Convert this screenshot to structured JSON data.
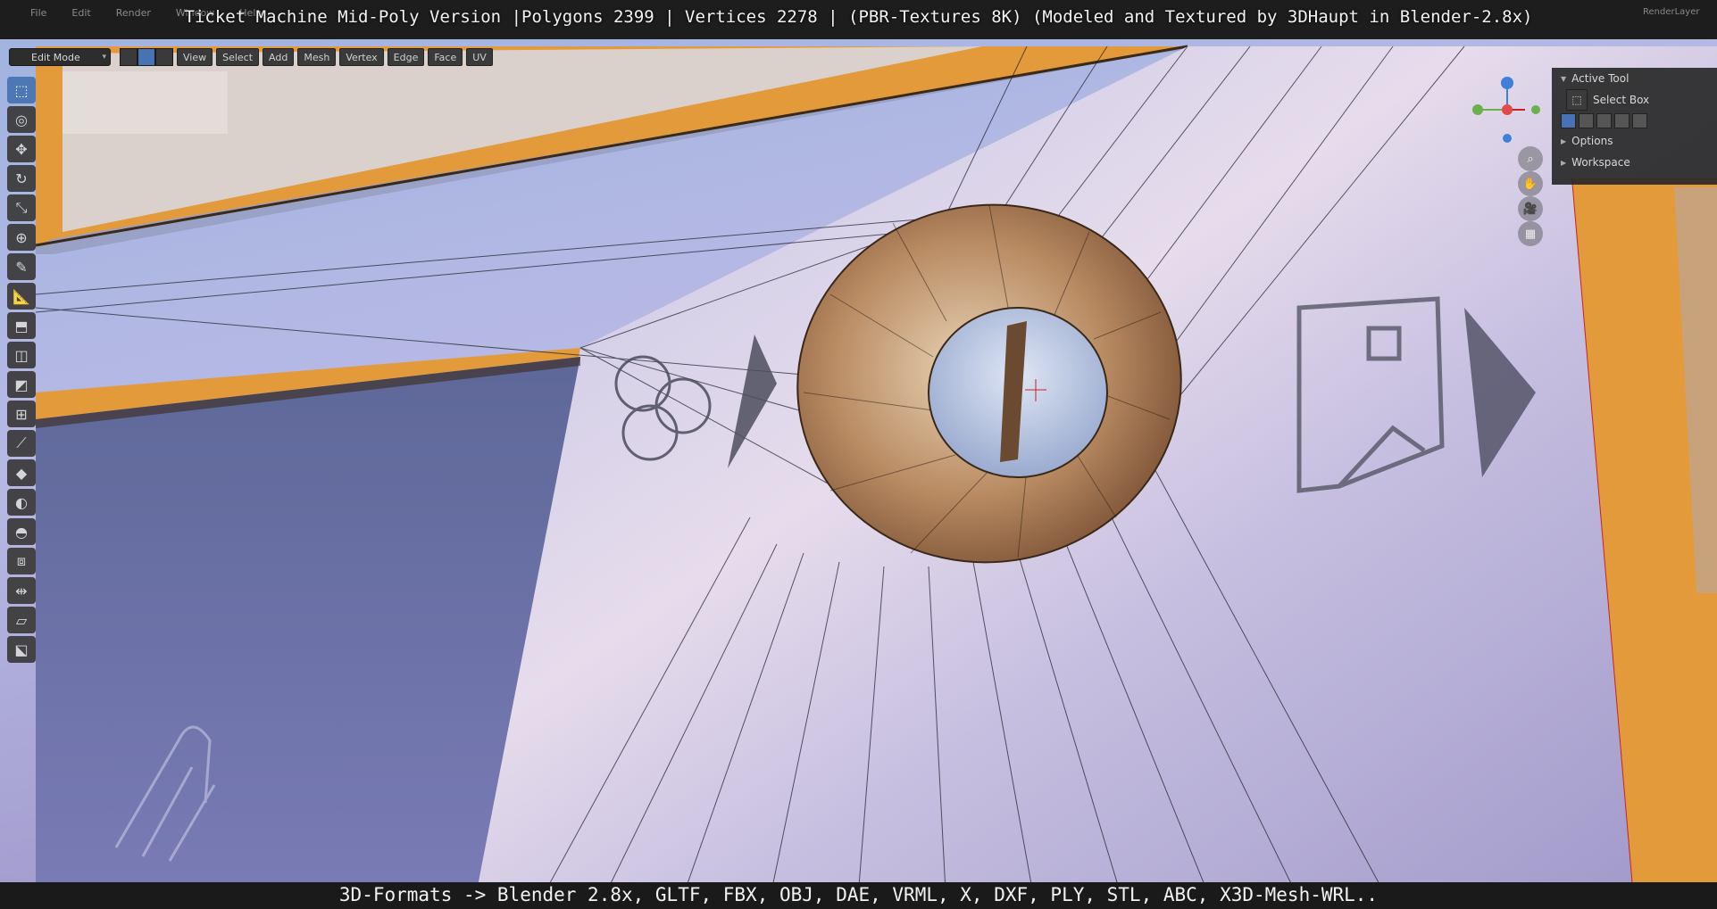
{
  "title_overlay": "Ticket Machine Mid-Poly Version |Polygons 2399 | Vertices 2278 | (PBR-Textures 8K) (Modeled and Textured by 3DHaupt in Blender-2.8x)",
  "bottom_overlay": "3D-Formats -> Blender 2.8x, GLTF, FBX, OBJ, DAE, VRML, X, DXF, PLY, STL, ABC, X3D-Mesh-WRL..",
  "top_menu": [
    "File",
    "Edit",
    "Render",
    "Window",
    "Help"
  ],
  "top_right": "RenderLayer",
  "header": {
    "mode": "Edit Mode",
    "menus": [
      "View",
      "Select",
      "Add",
      "Mesh",
      "Vertex",
      "Edge",
      "Face",
      "UV"
    ]
  },
  "sidebar": {
    "active_tool_label": "Active Tool",
    "tool_name": "Select Box",
    "options_label": "Options",
    "workspace_label": "Workspace"
  },
  "toolbar": [
    {
      "name": "select-box-tool",
      "glyph": "⬚",
      "active": true
    },
    {
      "name": "cursor-tool",
      "glyph": "◎"
    },
    {
      "name": "move-tool",
      "glyph": "✥"
    },
    {
      "name": "rotate-tool",
      "glyph": "↻"
    },
    {
      "name": "scale-tool",
      "glyph": "⤡"
    },
    {
      "name": "transform-tool",
      "glyph": "⊕"
    },
    {
      "name": "annotate-tool",
      "glyph": "✎"
    },
    {
      "name": "measure-tool",
      "glyph": "📐"
    },
    {
      "name": "extrude-tool",
      "glyph": "⬒"
    },
    {
      "name": "inset-tool",
      "glyph": "◫"
    },
    {
      "name": "bevel-tool",
      "glyph": "◩"
    },
    {
      "name": "loop-cut-tool",
      "glyph": "⊞"
    },
    {
      "name": "knife-tool",
      "glyph": "⟋"
    },
    {
      "name": "poly-build-tool",
      "glyph": "◆"
    },
    {
      "name": "spin-tool",
      "glyph": "◐"
    },
    {
      "name": "smooth-tool",
      "glyph": "◓"
    },
    {
      "name": "edge-slide-tool",
      "glyph": "⧈"
    },
    {
      "name": "shrink-fatten-tool",
      "glyph": "⇹"
    },
    {
      "name": "shear-tool",
      "glyph": "▱"
    },
    {
      "name": "rip-tool",
      "glyph": "⬕"
    }
  ],
  "colors": {
    "accent": "#4772b3",
    "orange_frame": "#e39a3a",
    "panel_bg": "#282828"
  }
}
